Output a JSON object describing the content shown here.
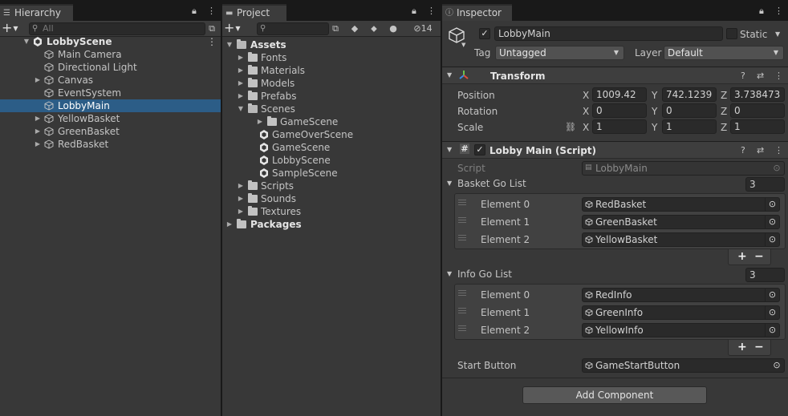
{
  "hierarchy": {
    "tab_label": "Hierarchy",
    "search_placeholder": "All",
    "scene": "LobbyScene",
    "items": [
      {
        "label": "Main Camera",
        "expandable": false,
        "selected": false
      },
      {
        "label": "Directional Light",
        "expandable": false,
        "selected": false
      },
      {
        "label": "Canvas",
        "expandable": true,
        "selected": false
      },
      {
        "label": "EventSystem",
        "expandable": false,
        "selected": false
      },
      {
        "label": "LobbyMain",
        "expandable": false,
        "selected": true
      },
      {
        "label": "YellowBasket",
        "expandable": true,
        "selected": false
      },
      {
        "label": "GreenBasket",
        "expandable": true,
        "selected": false
      },
      {
        "label": "RedBasket",
        "expandable": true,
        "selected": false
      }
    ]
  },
  "project": {
    "tab_label": "Project",
    "hidden_count": "14",
    "assets_label": "Assets",
    "tree": [
      {
        "label": "Fonts",
        "type": "folder",
        "depth": 1
      },
      {
        "label": "Materials",
        "type": "folder",
        "depth": 1
      },
      {
        "label": "Models",
        "type": "folder",
        "depth": 1
      },
      {
        "label": "Prefabs",
        "type": "folder",
        "depth": 1
      },
      {
        "label": "Scenes",
        "type": "folder-open",
        "depth": 1
      },
      {
        "label": "GameScene",
        "type": "folder",
        "depth": 2
      },
      {
        "label": "GameOverScene",
        "type": "scene",
        "depth": 2
      },
      {
        "label": "GameScene",
        "type": "scene",
        "depth": 2
      },
      {
        "label": "LobbyScene",
        "type": "scene",
        "depth": 2
      },
      {
        "label": "SampleScene",
        "type": "scene",
        "depth": 2
      },
      {
        "label": "Scripts",
        "type": "folder",
        "depth": 1
      },
      {
        "label": "Sounds",
        "type": "folder",
        "depth": 1
      },
      {
        "label": "Textures",
        "type": "folder",
        "depth": 1
      }
    ],
    "packages_label": "Packages"
  },
  "inspector": {
    "tab_label": "Inspector",
    "object_name": "LobbyMain",
    "static_label": "Static",
    "tag_label": "Tag",
    "tag_value": "Untagged",
    "layer_label": "Layer",
    "layer_value": "Default",
    "transform": {
      "title": "Transform",
      "position_label": "Position",
      "rotation_label": "Rotation",
      "scale_label": "Scale",
      "position": {
        "x": "1009.42",
        "y": "742.1239",
        "z": "3.738473"
      },
      "rotation": {
        "x": "0",
        "y": "0",
        "z": "0"
      },
      "scale": {
        "x": "1",
        "y": "1",
        "z": "1"
      }
    },
    "script_component": {
      "title": "Lobby Main (Script)",
      "script_label": "Script",
      "script_value": "LobbyMain",
      "basket_list_label": "Basket Go List",
      "basket_list_size": "3",
      "basket_elements": [
        {
          "label": "Element 0",
          "value": "RedBasket"
        },
        {
          "label": "Element 1",
          "value": "GreenBasket"
        },
        {
          "label": "Element 2",
          "value": "YellowBasket"
        }
      ],
      "info_list_label": "Info Go List",
      "info_list_size": "3",
      "info_elements": [
        {
          "label": "Element 0",
          "value": "RedInfo"
        },
        {
          "label": "Element 1",
          "value": "GreenInfo"
        },
        {
          "label": "Element 2",
          "value": "YellowInfo"
        }
      ],
      "start_button_label": "Start Button",
      "start_button_value": "GameStartButton"
    },
    "add_component_label": "Add Component"
  },
  "colors": {
    "panel_bg": "#383838",
    "selection": "#2c5d87",
    "field_bg": "#2a2a2a"
  }
}
